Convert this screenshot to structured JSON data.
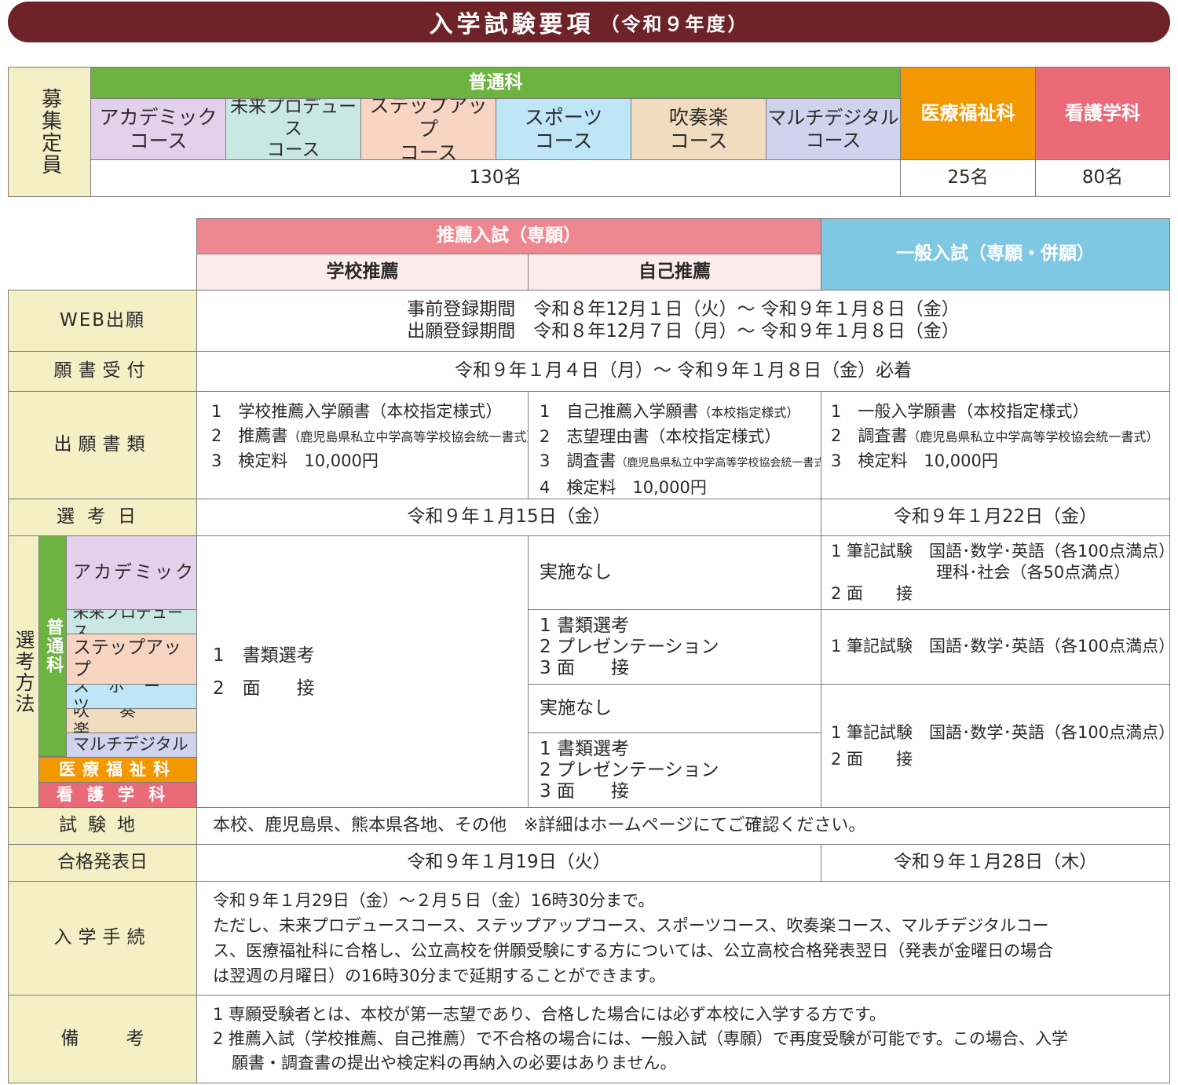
{
  "title": {
    "main": "入学試験要項",
    "sub": "（令和９年度）"
  },
  "capacity": {
    "label": "募集定員",
    "general": {
      "name": "普通科",
      "courses": [
        {
          "l1": "アカデミック",
          "l2": "コース"
        },
        {
          "l1": "未来プロデュース",
          "l2": "コース"
        },
        {
          "l1": "ステップアップ",
          "l2": "コース"
        },
        {
          "l1": "スポーツ",
          "l2": "コース"
        },
        {
          "l1": "吹奏楽",
          "l2": "コース"
        },
        {
          "l1": "マルチデジタル",
          "l2": "コース"
        }
      ],
      "count": "130名"
    },
    "welfare": {
      "name": "医療福祉科",
      "count": "25名"
    },
    "nursing": {
      "name": "看護学科",
      "count": "80名"
    }
  },
  "exam": {
    "recommend_header": "推薦入試（専願）",
    "school_rec": "学校推薦",
    "self_rec": "自己推薦",
    "general_header": "一般入試（専願・併願）"
  },
  "rows": {
    "web": {
      "label": "WEB出願",
      "line1": "事前登録期間　令和８年12月１日（火）～ 令和９年１月８日（金）",
      "line2": "出願登録期間　令和８年12月７日（月）～ 令和９年１月８日（金）"
    },
    "accept": {
      "label": "願書受付",
      "text": "令和９年１月４日（月）～ 令和９年１月８日（金）必着"
    },
    "docs": {
      "label": "出願書類",
      "school": {
        "l1": "1　学校推薦入学願書（本校指定様式）",
        "l2a": "2　推薦書",
        "l2b": "（鹿児島県私立中学高等学校協会統一書式）",
        "l3": "3　検定料　10,000円"
      },
      "self": {
        "l1a": "1　自己推薦入学願書",
        "l1b": "（本校指定様式）",
        "l2": "2　志望理由書（本校指定様式）",
        "l3a": "3　調査書",
        "l3b": "（鹿児島県私立中学高等学校協会統一書式）",
        "l4": "4　検定料　10,000円"
      },
      "general": {
        "l1": "1　一般入学願書（本校指定様式）",
        "l2a": "2　調査書",
        "l2b": "（鹿児島県私立中学高等学校協会統一書式）",
        "l3": "3　検定料　10,000円"
      }
    },
    "date": {
      "label": "選考日",
      "rec": "令和９年１月15日（金）",
      "general": "令和９年１月22日（金）"
    },
    "method": {
      "label": "選考方法",
      "general_label": "普通科",
      "courses": [
        "アカデミック",
        "未来プロデュース",
        "ステップアップ",
        "スポーツ",
        "吹奏楽",
        "マルチデジタル"
      ],
      "welfare": "医療福祉科",
      "nursing": "看護学科",
      "school": {
        "l1": "1　書類選考",
        "l2": "2　面　　接"
      },
      "self_none": "実施なし",
      "self_docs": {
        "l1": "1 書類選考",
        "l2": "2 プレゼンテーション",
        "l3": "3 面　　接"
      },
      "gen_academic": {
        "l1": "1 筆記試験　国語･数学･英語（各100点満点）",
        "l2": "理科･社会（各50点満点）",
        "l3": "2 面　　接"
      },
      "gen_written": "1 筆記試験　国語･数学･英語（各100点満点）",
      "gen_interview": "2 面　　接"
    },
    "place": {
      "label": "試験地",
      "text": "本校、鹿児島県、熊本県各地、その他　※詳細はホームページにてご確認ください。"
    },
    "result": {
      "label": "合格発表日",
      "rec": "令和９年１月19日（火）",
      "general": "令和９年１月28日（木）"
    },
    "procedure": {
      "label": "入学手続",
      "l1": "令和９年１月29日（金）～２月５日（金）16時30分まで。",
      "l2": "ただし、未来プロデュースコース、ステップアップコース、スポーツコース、吹奏楽コース、マルチデジタルコー",
      "l3": "ス、医療福祉科に合格し、公立高校を併願受験にする方については、公立高校合格発表翌日（発表が金曜日の場合",
      "l4": "は翌週の月曜日）の16時30分まで延期することができます。"
    },
    "notes": {
      "label": "備考",
      "l1": "1 専願受験者とは、本校が第一志望であり、合格した場合には必ず本校に入学する方です。",
      "l2": "2 推薦入試（学校推薦、自己推薦）で不合格の場合には、一般入試（専願）で再度受験が可能です。この場合、入学",
      "l3": "願書・調査書の提出や検定料の再納入の必要はありません。"
    }
  },
  "colors": {
    "title_bg": "#6e2328",
    "label_bg": "#f4efc4",
    "general_green": "#6db33f",
    "welfare_orange": "#f39800",
    "nursing_pink": "#ea6a78",
    "recommend_pink": "#ef8790",
    "recommend_light": "#fdecec",
    "general_blue": "#7ec8e3",
    "academic": "#e3d0ea",
    "future": "#c9e8e3",
    "step": "#f8d5c2",
    "sports": "#bfe6f7",
    "band": "#f1dcc0",
    "digital": "#cfd3ee"
  }
}
